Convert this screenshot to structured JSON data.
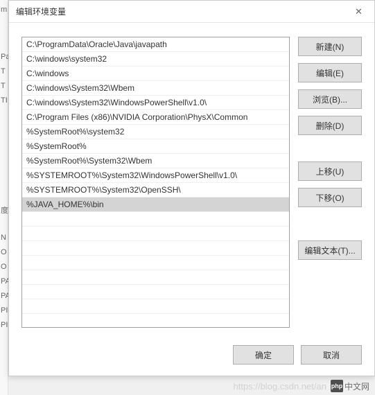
{
  "dialog": {
    "title": "编辑环境变量",
    "close_icon": "✕"
  },
  "list": {
    "items": [
      "C:\\ProgramData\\Oracle\\Java\\javapath",
      "C:\\windows\\system32",
      "C:\\windows",
      "C:\\windows\\System32\\Wbem",
      "C:\\windows\\System32\\WindowsPowerShell\\v1.0\\",
      "C:\\Program Files (x86)\\NVIDIA Corporation\\PhysX\\Common",
      "%SystemRoot%\\system32",
      "%SystemRoot%",
      "%SystemRoot%\\System32\\Wbem",
      "%SYSTEMROOT%\\System32\\WindowsPowerShell\\v1.0\\",
      "%SYSTEMROOT%\\System32\\OpenSSH\\",
      "%JAVA_HOME%\\bin"
    ],
    "selected_index": 11
  },
  "buttons": {
    "new": "新建(N)",
    "edit": "编辑(E)",
    "browse": "浏览(B)...",
    "delete": "删除(D)",
    "move_up": "上移(U)",
    "move_down": "下移(O)",
    "edit_text": "编辑文本(T)...",
    "ok": "确定",
    "cancel": "取消"
  },
  "background_labels": [
    "m",
    "Pa",
    "T",
    "T",
    "TI",
    "度",
    "N",
    "O",
    "O",
    "PA",
    "PA",
    "PF",
    "PF"
  ],
  "watermark": {
    "url": "https://blog.csdn.net/an",
    "logo_icon": "php",
    "logo_text": "中文网"
  }
}
